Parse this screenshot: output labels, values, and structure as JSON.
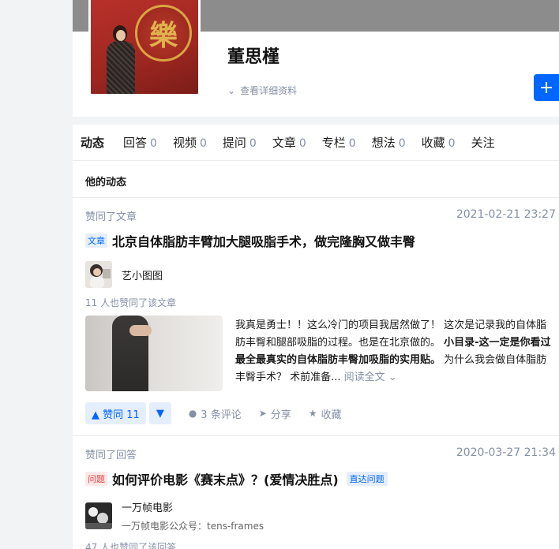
{
  "profile": {
    "name": "董思槿",
    "detail_link": "查看详细资料",
    "avatar_seal": "樂",
    "follow_icon": "+"
  },
  "tabs": [
    {
      "label": "动态",
      "count": ""
    },
    {
      "label": "回答",
      "count": "0"
    },
    {
      "label": "视频",
      "count": "0"
    },
    {
      "label": "提问",
      "count": "0"
    },
    {
      "label": "文章",
      "count": "0"
    },
    {
      "label": "专栏",
      "count": "0"
    },
    {
      "label": "想法",
      "count": "0"
    },
    {
      "label": "收藏",
      "count": "0"
    },
    {
      "label": "关注",
      "count": ""
    }
  ],
  "section_title": "他的动态",
  "feed": {
    "item1": {
      "action": "赞同了文章",
      "time": "2021-02-21 23:27",
      "type_tag": "文章",
      "title": "北京自体脂肪丰臂加大腿吸脂手术，做完隆胸又做丰臀",
      "author": "艺小图图",
      "agree_count": "11 人也赞同了该文章",
      "excerpt_start": "我真是勇士！！这么冷门的项目我居然做了！ 这次是记录我的自体脂肪丰臀和腿部吸脂的过程。也是在北京做的。",
      "excerpt_bold": "小目录-这一定是你看过最全最真实的自体脂肪丰臀加吸脂的实用贴。",
      "excerpt_end": "为什么我会做自体脂肪丰臀手术？ 术前准备...",
      "read_more": "阅读全文 ⌄",
      "vote_label": "▲ 赞同 11",
      "vote_down": "▼",
      "comments": "3 条评论",
      "share": "分享",
      "collect": "收藏"
    },
    "item2": {
      "action": "赞同了回答",
      "time": "2020-03-27 21:34",
      "type_tag": "问题",
      "title": "如何评价电影《赛末点》？(爱情决胜点)",
      "direct_tag": "直达问题",
      "author": "一万帧电影",
      "author_sub": "一万帧电影公众号：tens-frames",
      "agree_count": "47 人也赞同了该回答"
    }
  },
  "icons": {
    "comment": "comment-icon",
    "share": "share-icon",
    "collect": "star-icon",
    "chevron": "chevron-down-icon"
  },
  "colors": {
    "accent": "#0066ff",
    "muted": "#8590a6",
    "question_tag": "#f1403c"
  }
}
